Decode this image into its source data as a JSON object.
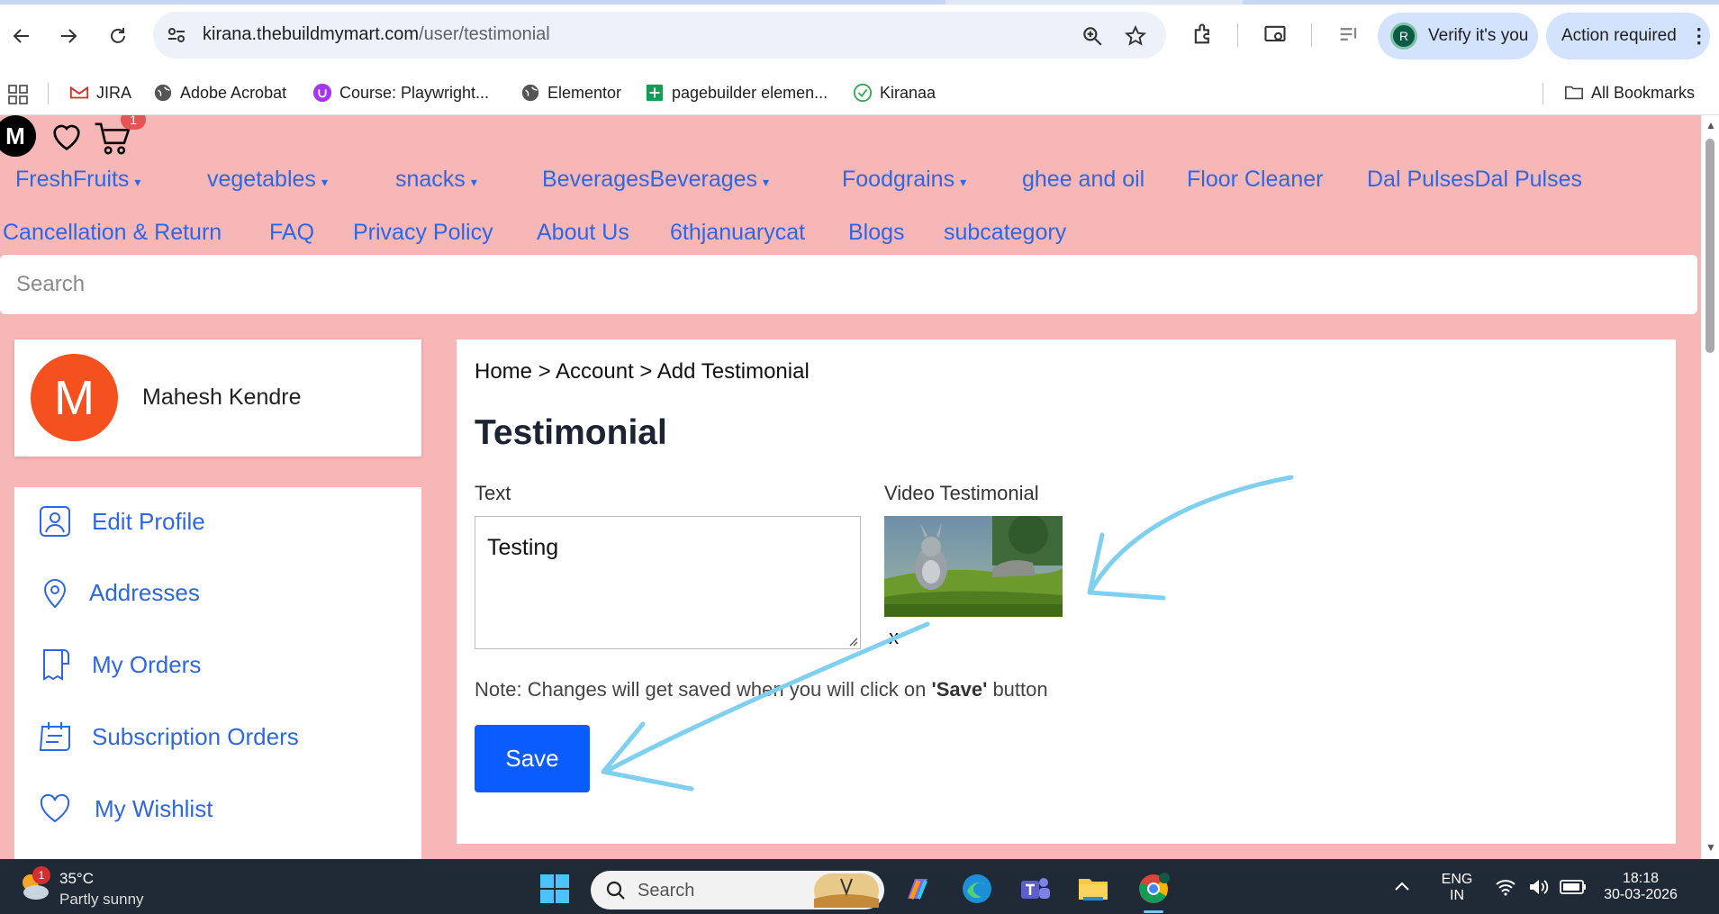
{
  "browser": {
    "url_host": "kirana.thebuildmymart.com",
    "url_path": "/user/testimonial",
    "verify_label": "Verify it's you",
    "verify_avatar": "R",
    "action_label": "Action required",
    "bookmarks": [
      {
        "label": "JIRA",
        "icon": "gmail-icon"
      },
      {
        "label": "Adobe Acrobat",
        "icon": "globe-icon"
      },
      {
        "label": "Course: Playwright...",
        "icon": "udemy-icon"
      },
      {
        "label": "Elementor",
        "icon": "globe-icon"
      },
      {
        "label": "pagebuilder elemen...",
        "icon": "sheets-icon"
      },
      {
        "label": "Kiranaa",
        "icon": "check-icon"
      }
    ],
    "all_bookmarks": "All Bookmarks"
  },
  "site": {
    "logo_letter": "M",
    "cart_count": "1",
    "nav_row1": [
      "FreshFruits",
      "vegetables",
      "snacks",
      "BeveragesBeverages",
      "Foodgrains",
      "ghee and oil",
      "Floor Cleaner",
      "Dal PulsesDal Pulses"
    ],
    "nav_row2": [
      "Cancellation & Return",
      "FAQ",
      "Privacy Policy",
      "About Us",
      "6thjanuarycat",
      "Blogs",
      "subcategory"
    ],
    "search_placeholder": "Search"
  },
  "profile": {
    "initial": "M",
    "name": "Mahesh Kendre",
    "avatar_color": "#f4511e"
  },
  "sidebar": {
    "items": [
      {
        "label": "Edit Profile",
        "icon": "user-icon"
      },
      {
        "label": "Addresses",
        "icon": "location-pin-icon"
      },
      {
        "label": "My Orders",
        "icon": "receipt-icon"
      },
      {
        "label": "Subscription Orders",
        "icon": "calendar-icon"
      },
      {
        "label": "My Wishlist",
        "icon": "heart-icon"
      }
    ]
  },
  "main": {
    "breadcrumb": "Home > Account > Add Testimonial",
    "title": "Testimonial",
    "text_label": "Text",
    "text_value": "Testing",
    "video_label": "Video Testimonial",
    "remove_label": "x",
    "note_prefix": "Note: Changes will get saved when you will click on ",
    "note_bold": "'Save'",
    "note_suffix": " button",
    "save_label": "Save"
  },
  "colors": {
    "page_bg": "#f7b7b6",
    "link": "#2d67e6",
    "save_button": "#0b5cff",
    "annotation_arrow": "#7fd0f0"
  },
  "taskbar": {
    "weather_temp": "35°C",
    "weather_desc": "Partly sunny",
    "weather_badge": "1",
    "search_label": "Search",
    "lang_top": "ENG",
    "lang_bottom": "IN",
    "time": "18:18",
    "date": "30-03-2026"
  }
}
